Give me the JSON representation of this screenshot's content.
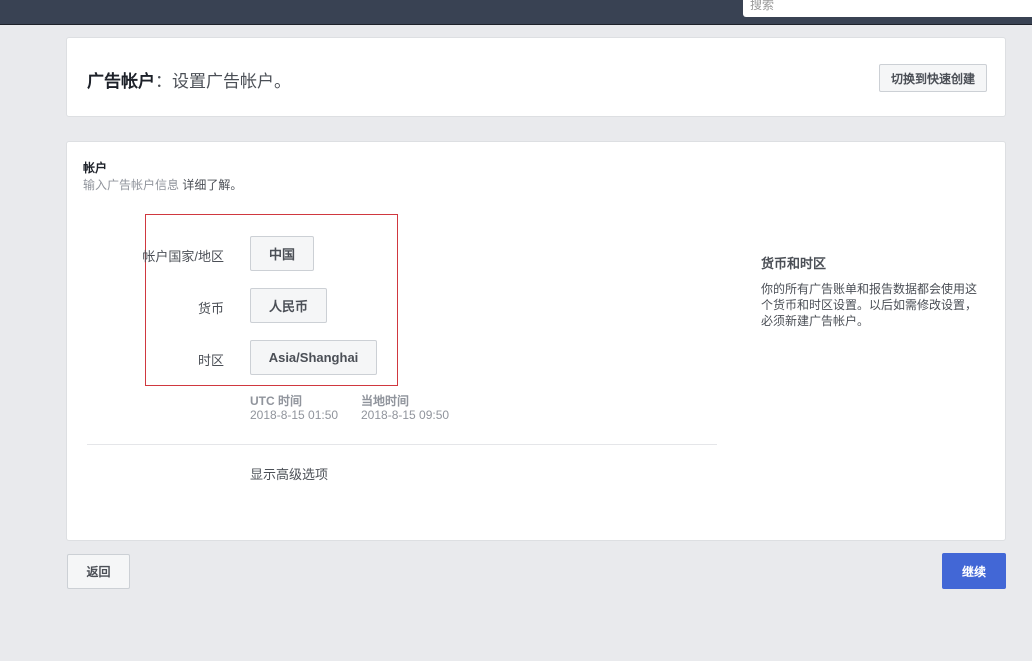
{
  "topbar": {
    "search_placeholder": "搜索"
  },
  "header": {
    "title_bold": "广告帐户",
    "title_rest": "：设置广告帐户。",
    "switch_button": "切换到快速创建"
  },
  "account": {
    "section_title": "帐户",
    "section_desc": "输入广告帐户信息",
    "learn_more": "详细了解。",
    "fields": [
      {
        "label": "帐户国家/地区",
        "value": "中国"
      },
      {
        "label": "货币",
        "value": "人民币"
      },
      {
        "label": "时区",
        "value": "Asia/Shanghai"
      }
    ],
    "utc_label": "UTC 时间",
    "utc_value": "2018-8-15 01:50",
    "local_label": "当地时间",
    "local_value": "2018-8-15 09:50",
    "advanced_link": "显示高级选项"
  },
  "side": {
    "title": "货币和时区",
    "text": "你的所有广告账单和报告数据都会使用这个货币和时区设置。以后如需修改设置，必须新建广告帐户。"
  },
  "footer": {
    "back": "返回",
    "continue": "继续"
  },
  "colors": {
    "accent": "#4267d6",
    "highlight": "#d0383f"
  }
}
